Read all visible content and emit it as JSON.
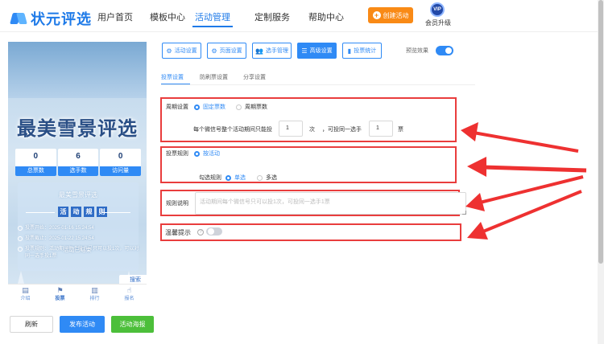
{
  "header": {
    "logo_text": "状元评选",
    "nav": [
      "用户首页",
      "模板中心",
      "活动管理",
      "定制服务",
      "帮助中心"
    ],
    "active_nav": "活动管理",
    "create_label": "创建活动",
    "vip_badge": "VIP",
    "vip_label": "会员升级"
  },
  "phone": {
    "title": "最美雪景评选",
    "stats": [
      {
        "value": "0",
        "label": "总票数"
      },
      {
        "value": "6",
        "label": "选手数"
      },
      {
        "value": "0",
        "label": "访问量"
      }
    ],
    "panel_title": "最美雪景评选",
    "rule_chars": [
      "活",
      "动",
      "规",
      "则"
    ],
    "rules": [
      "投票开始：2025-01-16 15:24:54",
      "投票截止：2025-01-22 15:24:54",
      "投票规则：活动期间每个微信号只可以投1次，可以对同一选手投1票"
    ],
    "event_ended": "活动已结束",
    "search_float": "搜索",
    "tabs": [
      {
        "icon": "▤",
        "label": "介绍"
      },
      {
        "icon": "⚑",
        "label": "投票"
      },
      {
        "icon": "▥",
        "label": "排行"
      },
      {
        "icon": "☝",
        "label": "报名"
      }
    ],
    "active_tab": "投票"
  },
  "actions": {
    "refresh": "刷新",
    "publish": "发布活动",
    "review": "活动海报"
  },
  "toolbar": {
    "buttons": [
      {
        "icon": "⚙",
        "label": "活动设置"
      },
      {
        "icon": "⚙",
        "label": "页面设置"
      },
      {
        "icon": "👥",
        "label": "选手管理"
      },
      {
        "icon": "☰",
        "label": "高级设置"
      },
      {
        "icon": "▮",
        "label": "投票统计"
      }
    ],
    "active": "高级设置",
    "preview_label": "预览效果",
    "preview_on": true
  },
  "subtabs": [
    "投票设置",
    "防刷票设置",
    "分享设置"
  ],
  "active_subtab": "投票设置",
  "form": {
    "cycle_label": "周期设置",
    "cycle_options": [
      "固定票数",
      "周期票数"
    ],
    "cycle_selected": "固定票数",
    "limit_prefix": "每个微信号整个活动期间只能投",
    "limit_value": "1",
    "limit_unit": "次",
    "limit_mid": "，可投同一选手",
    "same_value": "1",
    "same_unit": "票",
    "rule_label": "投票规则",
    "rule_option": "按活动",
    "check_label": "勾选规则",
    "check_options": [
      "单选",
      "多选"
    ],
    "check_selected": "单选",
    "desc_label": "规则说明",
    "desc_placeholder": "活动期间每个微信号只可以投1次，可投同一选手1票",
    "tip_label": "温馨提示",
    "tip_help": "?",
    "tip_on": false
  },
  "colors": {
    "primary": "#2f8af5",
    "orange": "#f98a16",
    "green": "#4cbf3a",
    "highlight_red": "#e93d3d"
  }
}
